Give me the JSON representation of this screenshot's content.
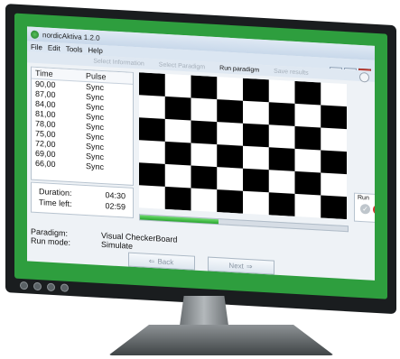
{
  "window": {
    "title": "nordicAktiva 1.2.0",
    "menu": [
      "File",
      "Edit",
      "Tools",
      "Help"
    ],
    "controls": {
      "minimize": "_",
      "maximize": "□",
      "close": "x"
    }
  },
  "steps": {
    "items": [
      "Select Information",
      "Select Paradigm",
      "Run paradigm",
      "Save results"
    ],
    "active_index": 2
  },
  "table": {
    "headers": {
      "time": "Time",
      "pulse": "Pulse"
    },
    "rows": [
      {
        "time": "90,00",
        "pulse": "Sync"
      },
      {
        "time": "87,00",
        "pulse": "Sync"
      },
      {
        "time": "84,00",
        "pulse": "Sync"
      },
      {
        "time": "81,00",
        "pulse": "Sync"
      },
      {
        "time": "78,00",
        "pulse": "Sync"
      },
      {
        "time": "75,00",
        "pulse": "Sync"
      },
      {
        "time": "72,00",
        "pulse": "Sync"
      },
      {
        "time": "69,00",
        "pulse": "Sync"
      },
      {
        "time": "66,00",
        "pulse": "Sync"
      }
    ]
  },
  "timing": {
    "duration_label": "Duration:",
    "duration_value": "04:30",
    "time_left_label": "Time left:",
    "time_left_value": "02:59"
  },
  "progress": {
    "fraction": 0.38
  },
  "run_panel": {
    "label": "Run",
    "ok_icon": "check-icon",
    "cancel_icon": "cancel-icon"
  },
  "meta": {
    "paradigm_label": "Paradigm:",
    "paradigm_value": "Visual CheckerBoard",
    "run_mode_label": "Run mode:",
    "run_mode_value": "Simulate"
  },
  "nav": {
    "back_label": "Back",
    "next_label": "Next"
  },
  "colors": {
    "bezel_accent": "#2e9e3e",
    "progress": "#29a52f",
    "cancel": "#d3342f"
  }
}
